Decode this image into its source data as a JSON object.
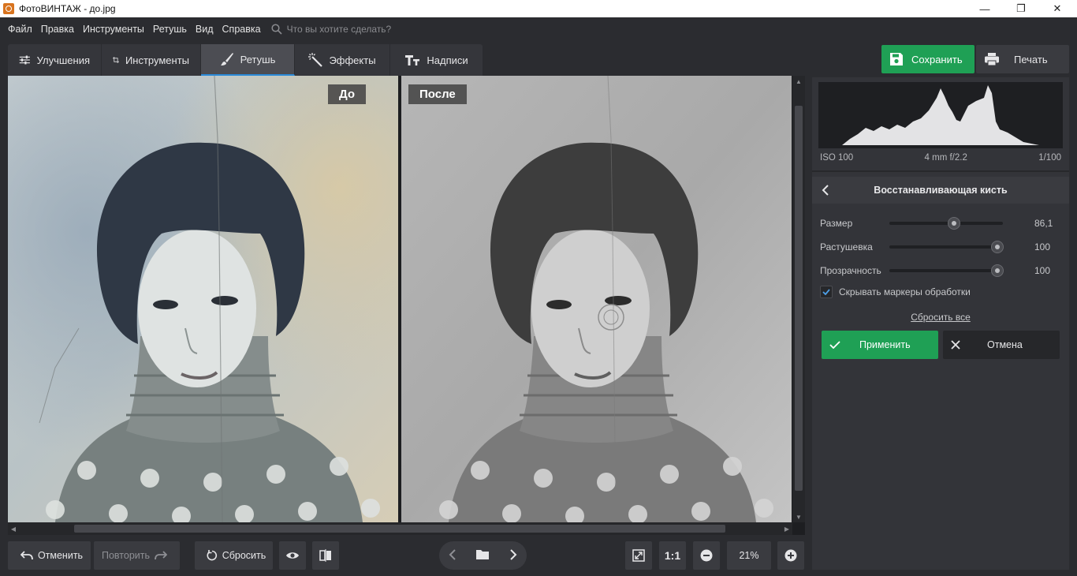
{
  "window": {
    "title": "ФотоВИНТАЖ - до.jpg",
    "minimize": "—",
    "maximize": "❐",
    "close": "✕"
  },
  "menu": {
    "items": [
      "Файл",
      "Правка",
      "Инструменты",
      "Ретушь",
      "Вид",
      "Справка"
    ],
    "search_placeholder": "Что вы хотите сделать?"
  },
  "tabs": [
    {
      "label": "Улучшения",
      "icon": "sliders-icon"
    },
    {
      "label": "Инструменты",
      "icon": "crop-icon"
    },
    {
      "label": "Ретушь",
      "icon": "brush-icon",
      "active": true
    },
    {
      "label": "Эффекты",
      "icon": "magic-wand-icon"
    },
    {
      "label": "Надписи",
      "icon": "text-icon"
    }
  ],
  "actions": {
    "save": "Сохранить",
    "print": "Печать"
  },
  "view": {
    "before_label": "До",
    "after_label": "После"
  },
  "bottom": {
    "undo": "Отменить",
    "redo": "Повторить",
    "reset": "Сбросить",
    "ratio": "1:1",
    "zoom": "21%"
  },
  "panel": {
    "exif": {
      "iso": "ISO 100",
      "lens": "4 mm f/2.2",
      "shutter": "1/100"
    },
    "title": "Восстанавливающая кисть",
    "sliders": [
      {
        "label": "Размер",
        "value": "86,1",
        "fraction": 0.57
      },
      {
        "label": "Растушевка",
        "value": "100",
        "fraction": 1.0
      },
      {
        "label": "Прозрачность",
        "value": "100",
        "fraction": 1.0
      }
    ],
    "checkbox": {
      "label": "Скрывать маркеры обработки",
      "checked": true
    },
    "reset_all": "Сбросить все",
    "apply": "Применить",
    "cancel": "Отмена"
  },
  "colors": {
    "accent_green": "#1fa055",
    "active_tab_underline": "#2a8ad8",
    "panel_bg": "#333439"
  }
}
